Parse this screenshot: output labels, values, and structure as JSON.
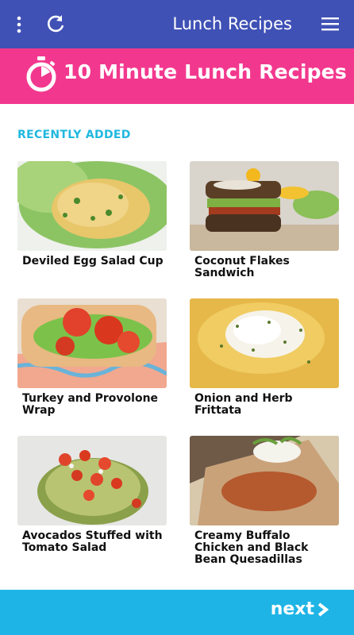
{
  "appbar": {
    "title": "Lunch Recipes",
    "color": "#3f51b5",
    "icons": [
      "more-vert-icon",
      "refresh-icon",
      "menu-icon"
    ]
  },
  "banner": {
    "title": "10 Minute Lunch Recipes",
    "color": "#f2388e",
    "icon": "timer-icon"
  },
  "section": {
    "title": "RECENTLY ADDED",
    "color": "#20b8e0"
  },
  "recipes": [
    {
      "title": "Deviled Egg Salad Cup"
    },
    {
      "title": "Coconut Flakes Sandwich"
    },
    {
      "title": "Turkey and Provolone Wrap"
    },
    {
      "title": "Onion and Herb Frittata"
    },
    {
      "title": "Avocados Stuffed with Tomato Salad"
    },
    {
      "title": "Creamy Buffalo Chicken and Black Bean Quesadillas"
    }
  ],
  "footer": {
    "next_label": "next",
    "color": "#1fb4e6",
    "icon": "chevron-right-icon"
  }
}
